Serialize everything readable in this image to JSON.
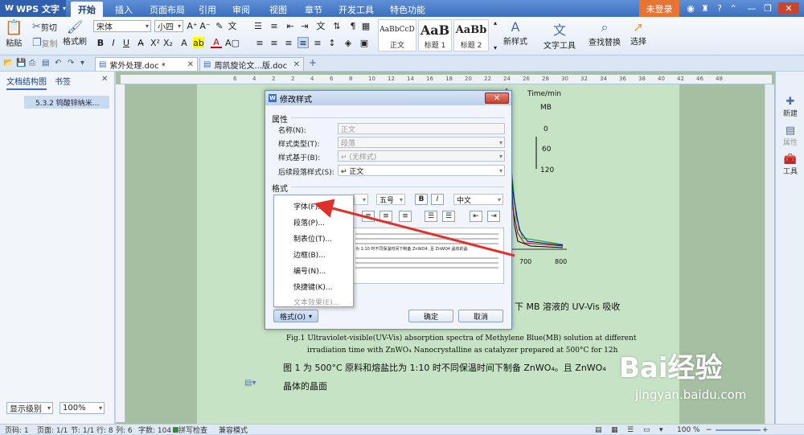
{
  "app": {
    "name": "WPS 文字",
    "login": "未登录"
  },
  "ribbon_tabs": [
    "开始",
    "插入",
    "页面布局",
    "引用",
    "审阅",
    "视图",
    "章节",
    "开发工具",
    "特色功能"
  ],
  "ribbon": {
    "paste": "粘贴",
    "cut": "剪切",
    "copy": "复制",
    "format_painter": "格式刷",
    "font_name": "宋体",
    "font_size": "小四",
    "styles": [
      {
        "sample": "AaBbCcD",
        "name": "正文"
      },
      {
        "sample": "AaB",
        "name": "标题 1"
      },
      {
        "sample": "AaBb",
        "name": "标题 2"
      }
    ],
    "new_style": "新样式",
    "text_tools": "文字工具",
    "find_replace": "查找替换",
    "select": "选择"
  },
  "doc_tabs": [
    {
      "name": "紫外处理.doc *",
      "active": true
    },
    {
      "name": "周凯旋论文...版.doc",
      "active": false
    }
  ],
  "nav": {
    "tabs": [
      "文档结构图",
      "书签"
    ],
    "item": "5.3.2 钨酸锌纳米...",
    "level_btn": "显示级别",
    "zoom": "100%"
  },
  "right_sidebar": [
    "新建",
    "属性",
    "工具"
  ],
  "chart_fragment": {
    "labels": [
      "Time/min",
      "MB",
      "0",
      "60",
      "120"
    ],
    "x_ticks": [
      "700",
      "800"
    ]
  },
  "dialog": {
    "title": "修改样式",
    "section_props": "属性",
    "section_format": "格式",
    "fields": [
      {
        "label": "名称(N):",
        "value": "正文",
        "enabled": false
      },
      {
        "label": "样式类型(T):",
        "value": "段落",
        "enabled": false
      },
      {
        "label": "样式基于(B):",
        "value": "↵ (无样式)",
        "enabled": false
      },
      {
        "label": "后续段落样式(S):",
        "value": "↵ 正文",
        "enabled": true
      }
    ],
    "size_value": "五号",
    "bold": "B",
    "italic": "I",
    "lang_value": "中文",
    "preview_text": "为 1:10 时不同保温时间下制备 ZnWO4, 且 ZnWO4 晶体的晶",
    "format_btn": "格式(O)",
    "ok": "确定",
    "cancel": "取消"
  },
  "popup_menu": [
    {
      "label": "字体(F)...",
      "enabled": true
    },
    {
      "label": "段落(P)...",
      "enabled": true
    },
    {
      "label": "制表位(T)...",
      "enabled": true
    },
    {
      "label": "边框(B)...",
      "enabled": true
    },
    {
      "label": "编号(N)...",
      "enabled": true
    },
    {
      "label": "快捷键(K)...",
      "enabled": true
    },
    {
      "label": "文本效果(E)...",
      "enabled": false
    }
  ],
  "doc_text": {
    "cn_caption_tail": "下 MB 溶液的 UV-Vis 吸收",
    "en_caption_1": "Fig.1 Ultraviolet-visible(UV-Vis) absorption spectra of Methylene Blue(MB) solution at different",
    "en_caption_2": "irradiation time with ZnWO₄ Nanocrystalline as catalyzer prepared at 500°C for 12h",
    "cn_para_1": "图 1 为 500°C 原料和熔盐比为 1:10 时不同保温时间下制备 ZnWO₄。且 ZnWO₄",
    "cn_para_2": "晶体的晶面"
  },
  "status": {
    "page": "页码: 1",
    "pages": "页面: 1/1",
    "section": "节: 1/1",
    "row": "行: 8",
    "col": "列: 6",
    "words": "字数: 104",
    "spell": "拼写检查",
    "compat": "兼容模式",
    "zoom": "100 %"
  },
  "watermark": {
    "brand": "Bai经验",
    "url": "jingyan.baidu.com"
  },
  "colors": {
    "accent": "#3c6fbf",
    "login": "#e87433",
    "arrow": "#e0302a",
    "page": "#c7e3c5"
  }
}
